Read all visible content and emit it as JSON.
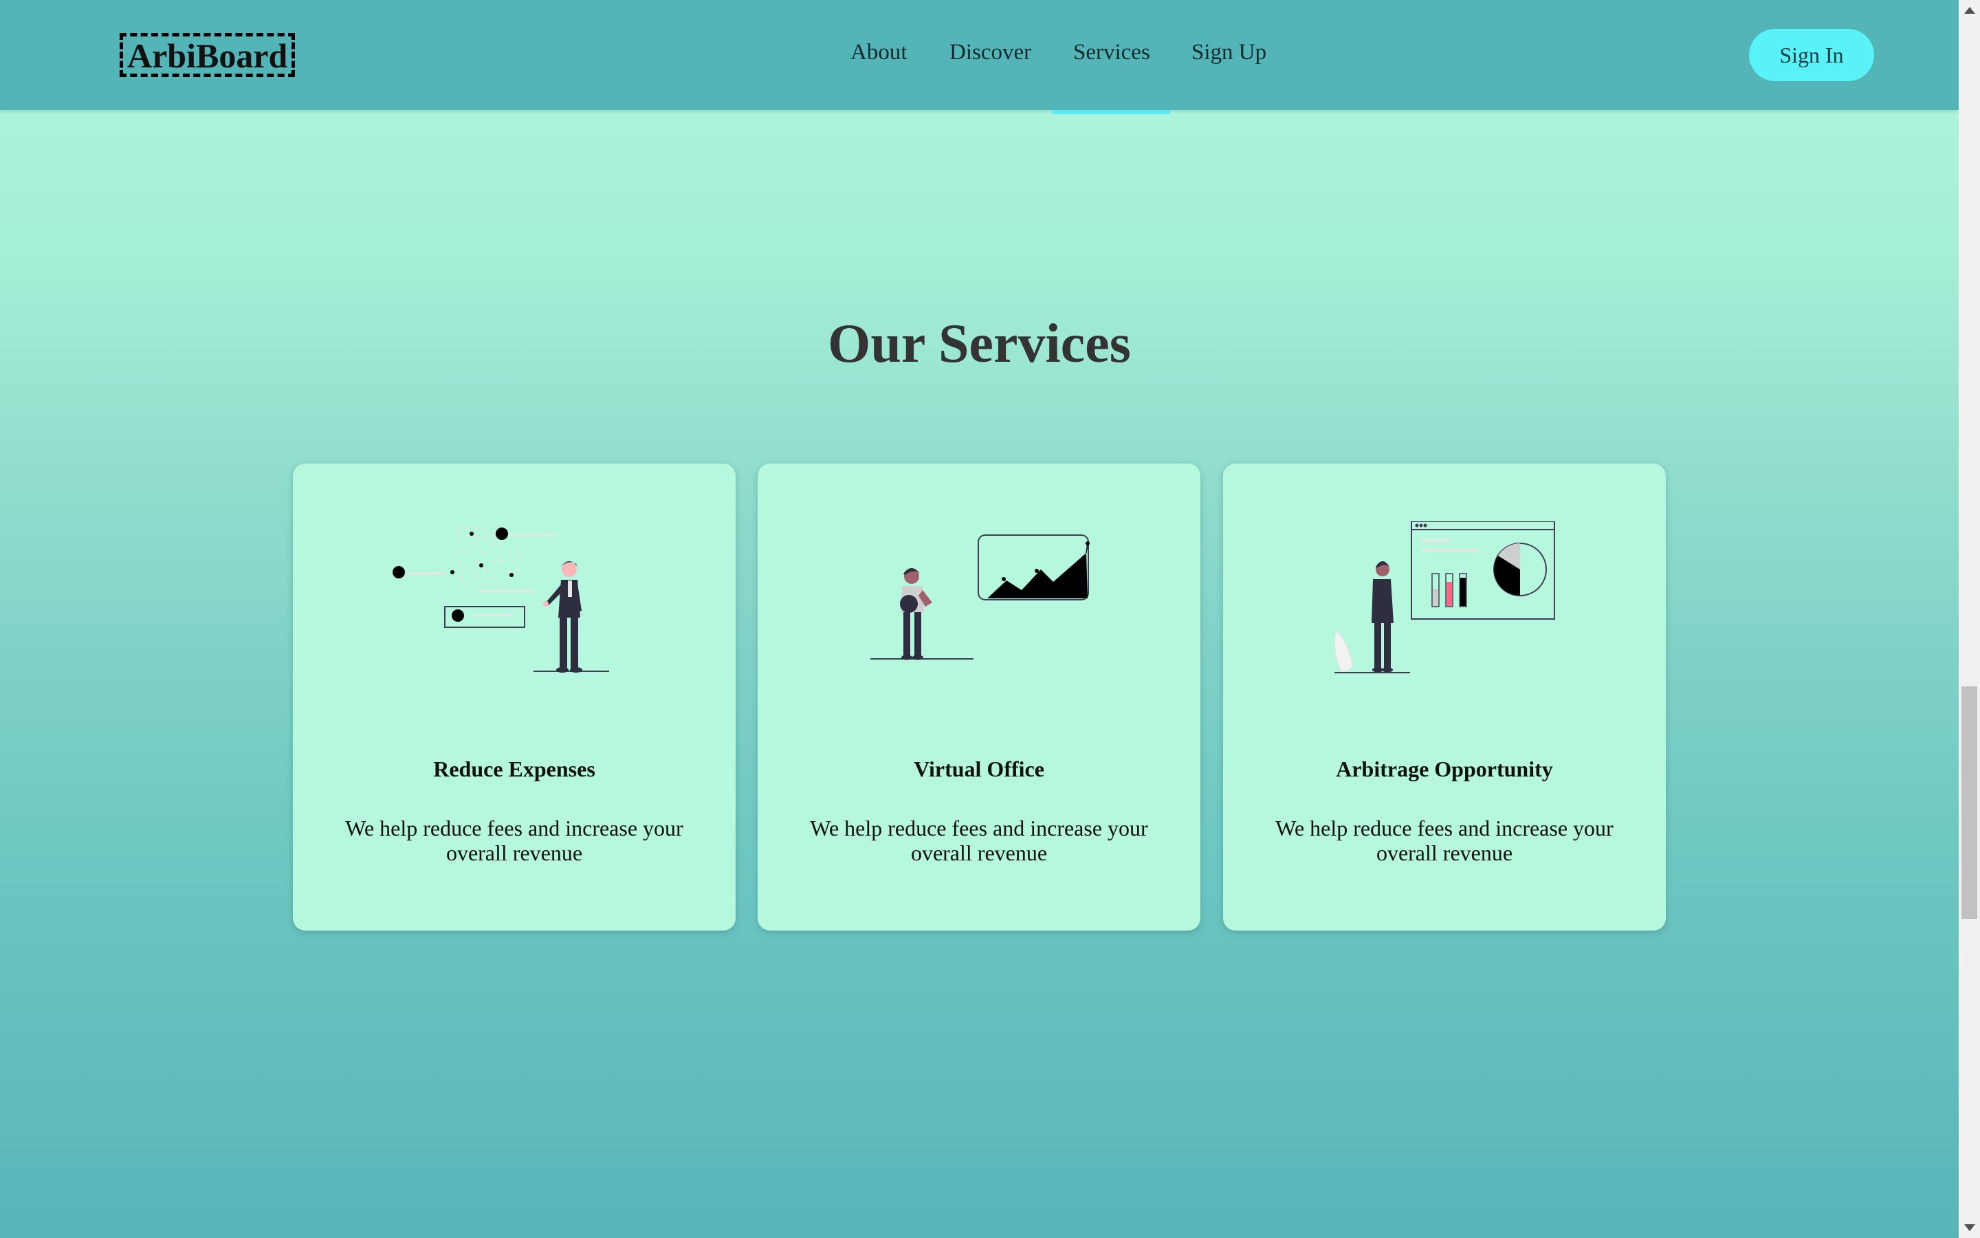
{
  "brand": {
    "logo_text": "ArbiBoard"
  },
  "nav": {
    "links": [
      "About",
      "Discover",
      "Services",
      "Sign Up"
    ],
    "active": "Services",
    "signin_label": "Sign In"
  },
  "services": {
    "title": "Our Services",
    "cards": [
      {
        "title": "Reduce Expenses",
        "description": "We help reduce fees and increase your overall revenue",
        "illustration": "presentation-illustration"
      },
      {
        "title": "Virtual Office",
        "description": "We help reduce fees and increase your overall revenue",
        "illustration": "growth-chart-illustration"
      },
      {
        "title": "Arbitrage Opportunity",
        "description": "We help reduce fees and increase your overall revenue",
        "illustration": "dashboard-analytics-illustration"
      }
    ]
  },
  "colors": {
    "navbar": "#53b5b8",
    "accent": "#58f2f8",
    "card": "#b5f8dd",
    "title": "#333333"
  }
}
